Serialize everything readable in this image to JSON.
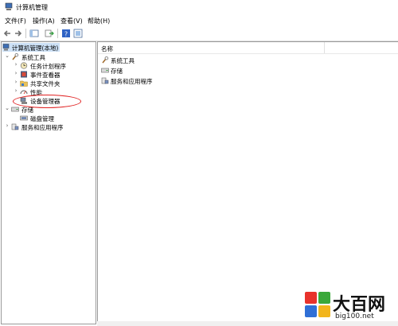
{
  "window": {
    "title": "计算机管理"
  },
  "menu": [
    {
      "label": "文件(F)"
    },
    {
      "label": "操作(A)"
    },
    {
      "label": "查看(V)"
    },
    {
      "label": "帮助(H)"
    }
  ],
  "toolbar": {
    "icons": [
      "back-arrow-icon",
      "forward-arrow-icon",
      "show-tree-icon",
      "export-list-icon",
      "help-icon",
      "properties-icon"
    ]
  },
  "tree": {
    "root": {
      "label": "计算机管理(本地)",
      "selected": true
    },
    "system_tools": {
      "label": "系统工具",
      "expanded": true,
      "children": [
        {
          "label": "任务计划程序",
          "expandable": true
        },
        {
          "label": "事件查看器",
          "expandable": true
        },
        {
          "label": "共享文件夹",
          "expandable": true
        },
        {
          "label": "性能",
          "expandable": true
        },
        {
          "label": "设备管理器",
          "expandable": false,
          "highlighted": true
        }
      ]
    },
    "storage": {
      "label": "存储",
      "expanded": true,
      "children": [
        {
          "label": "磁盘管理"
        }
      ]
    },
    "services": {
      "label": "服务和应用程序",
      "expandable": true
    }
  },
  "list": {
    "header": "名称",
    "items": [
      {
        "label": "系统工具"
      },
      {
        "label": "存储"
      },
      {
        "label": "服务和应用程序"
      }
    ]
  },
  "watermark": {
    "brand": "大百网",
    "url": "big100.net"
  },
  "colors": {
    "selection": "#cce0f5",
    "highlight_ring": "#e02020",
    "logo_red": "#e8322b",
    "logo_green": "#3aa83a",
    "logo_blue": "#2f6fd6",
    "logo_yellow": "#f2b51c"
  }
}
